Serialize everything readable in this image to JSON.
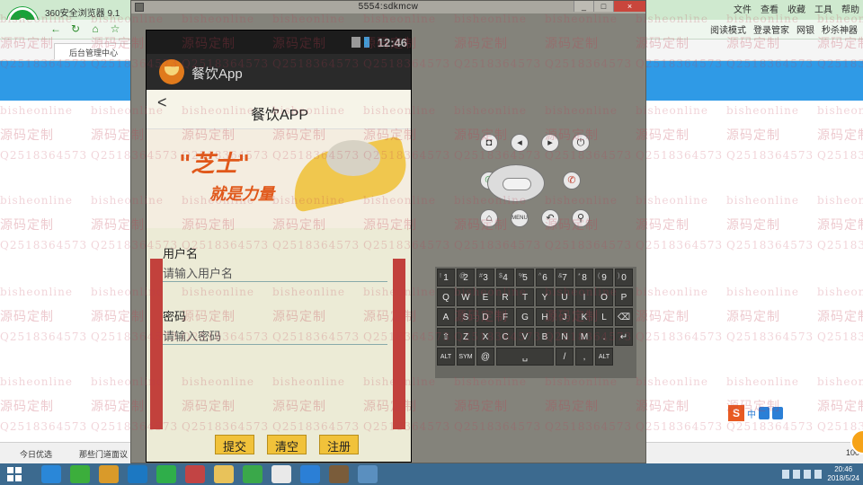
{
  "browser": {
    "title": "360安全浏览器 9.1",
    "logo_letter": "e",
    "menu": [
      "文件",
      "查看",
      "收藏",
      "工具",
      "帮助"
    ],
    "favorites": [
      "阅读模式",
      "登录管家",
      "网银",
      "秒杀神器"
    ],
    "tab_label": "后台管理中心",
    "status_items": [
      "今日优选",
      "那些门道面议"
    ],
    "zoom": "100",
    "sogou_letter": "S",
    "sogou_tool": "中"
  },
  "emulator": {
    "window_title": "5554:sdkmcw",
    "controls": [
      "_",
      "□",
      "×"
    ],
    "phone": {
      "time": "12:46",
      "app_name": "餐饮App",
      "header_title": "餐饮APP",
      "back_symbol": "<",
      "banner_main": "\"芝士\"",
      "banner_sub": "就是力量",
      "username_label": "用户名",
      "username_placeholder": "请输入用户名",
      "password_label": "密码",
      "password_placeholder": "请输入密码",
      "buttons": {
        "submit": "提交",
        "clear": "清空",
        "register": "注册"
      }
    },
    "hw_buttons": {
      "camera": "◘",
      "vol_down": "◂",
      "vol_up": "▸",
      "power": "⏻",
      "call": "✆",
      "end_call": "✆",
      "home": "⌂",
      "menu": "MENU",
      "back": "↶",
      "search": "⚲"
    },
    "keyboard": {
      "row1": [
        {
          "k": "1",
          "s": "!"
        },
        {
          "k": "2",
          "s": "@"
        },
        {
          "k": "3",
          "s": "#"
        },
        {
          "k": "4",
          "s": "$"
        },
        {
          "k": "5",
          "s": "%"
        },
        {
          "k": "6",
          "s": "^"
        },
        {
          "k": "7",
          "s": "&"
        },
        {
          "k": "8",
          "s": "*"
        },
        {
          "k": "9",
          "s": "("
        },
        {
          "k": "0",
          "s": ")"
        }
      ],
      "row2": [
        "Q",
        "W",
        "E",
        "R",
        "T",
        "Y",
        "U",
        "I",
        "O",
        "P"
      ],
      "row3": [
        "A",
        "S",
        "D",
        "F",
        "G",
        "H",
        "J",
        "K",
        "L",
        "⌫"
      ],
      "row4": [
        "⇧",
        "Z",
        "X",
        "C",
        "V",
        "B",
        "N",
        "M",
        ".",
        "↵"
      ],
      "row5": [
        "ALT",
        "SYM",
        "@",
        "␣",
        "/",
        ",",
        "ALT"
      ]
    }
  },
  "watermark": {
    "site": "bisheonline",
    "service": "源码定制",
    "qq": "Q2518364573"
  },
  "taskbar": {
    "time": "20:46",
    "date": "2018/5/24"
  },
  "colors": {
    "browser_blue": "#2f9ae6",
    "emulator_gray": "#87867f",
    "accent_red": "#c2413c",
    "button_yellow": "#f1c23a",
    "taskbar": "#3c6a8f"
  }
}
